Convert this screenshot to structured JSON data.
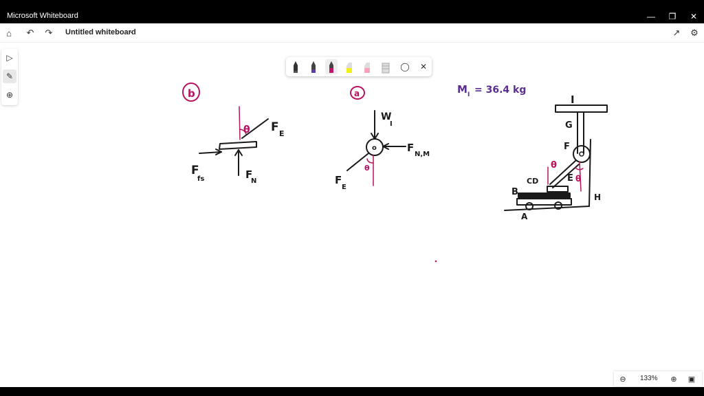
{
  "window": {
    "app_title": "Microsoft Whiteboard",
    "minimize_icon": "minimize-icon",
    "restore_icon": "restore-icon",
    "close_icon": "close-icon"
  },
  "appbar": {
    "board_title": "Untitled whiteboard",
    "icons": [
      "home-icon",
      "undo-icon",
      "redo-icon",
      "share-icon",
      "settings-icon"
    ]
  },
  "left_tools": [
    "select-icon",
    "pen-icon",
    "add-icon"
  ],
  "pen_tray": {
    "pens": [
      {
        "name": "black-pen",
        "color": "#222222"
      },
      {
        "name": "purple-pen",
        "color": "#5b3fa6"
      },
      {
        "name": "magenta-pen",
        "color": "#c0176b",
        "active": true
      },
      {
        "name": "yellow-highlighter",
        "color": "#f2f21a"
      },
      {
        "name": "pink-highlighter",
        "color": "#f4a4bb"
      },
      {
        "name": "eraser",
        "color": "#d8d8d8"
      }
    ],
    "lasso_icon": "lasso-icon",
    "close_icon": "close-icon"
  },
  "ink_colors": {
    "black": "#1a1a1a",
    "magenta": "#b8125f",
    "purple": "#5b2e91"
  },
  "canvas": {
    "diagram_b": {
      "label": "b",
      "theta": "θ",
      "forces": {
        "FE": "F",
        "FE_sub": "E",
        "Ffs": "F",
        "Ffs_sub": "fs",
        "FN": "F",
        "FN_sub": "N"
      }
    },
    "diagram_a": {
      "label": "a",
      "theta": "θ",
      "center": "o",
      "forces": {
        "WI": "W",
        "WI_sub": "I",
        "FNM": "F",
        "FNM_sub": "N,M",
        "FE": "F",
        "FE_sub": "E"
      }
    },
    "mass_note": "M",
    "mass_note_sub": "I",
    "mass_note_value": "= 36.4 kg",
    "system": {
      "labels": {
        "I": "I",
        "G": "G",
        "F": "F",
        "E": "E",
        "CD": "CD",
        "B": "B",
        "A": "A",
        "H": "H"
      },
      "theta1": "θ",
      "theta2": "θ"
    }
  },
  "zoom": {
    "value": "133%",
    "zoom_out_icon": "zoom-out-icon",
    "zoom_in_icon": "zoom-in-icon",
    "fit_icon": "fit-screen-icon"
  }
}
